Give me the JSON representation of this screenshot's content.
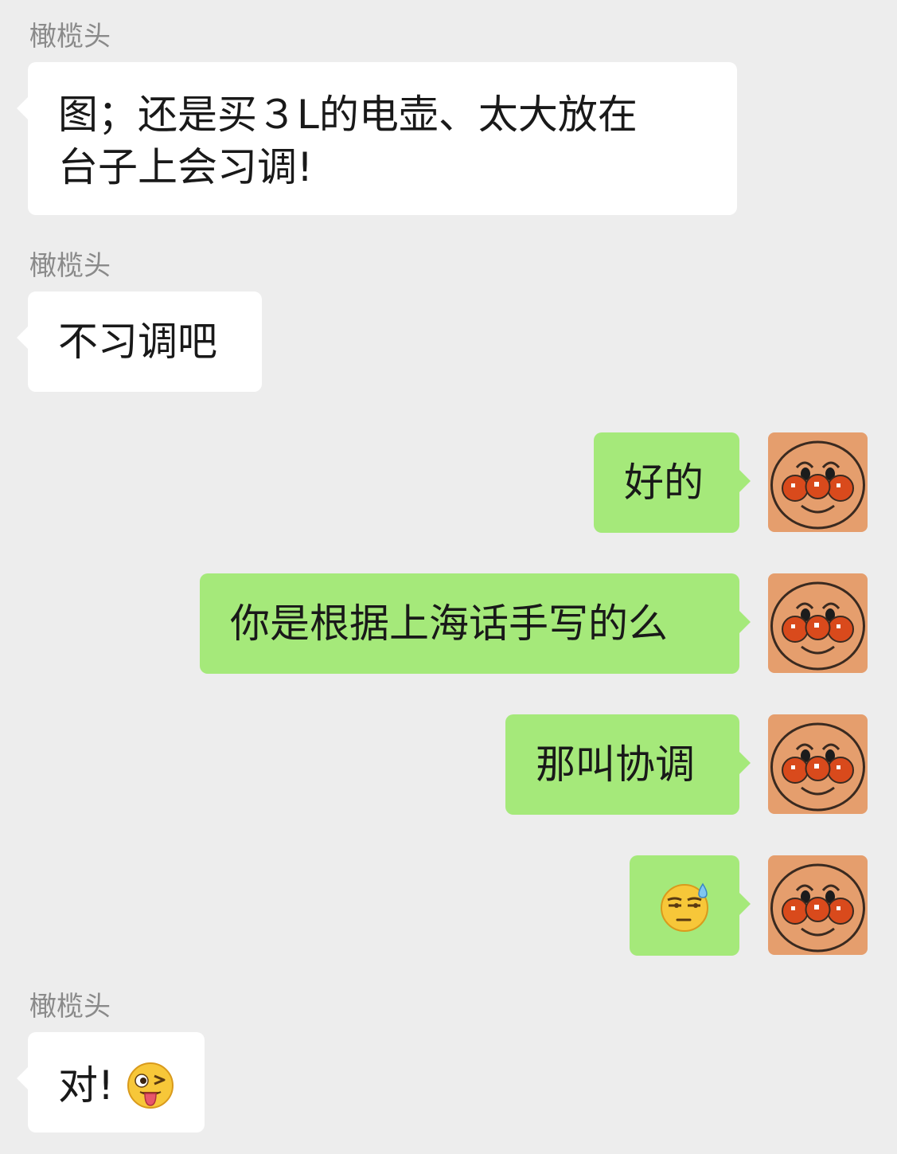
{
  "messages": [
    {
      "direction": "incoming",
      "sender": "橄榄头",
      "lines": [
        "图；还是买３L的电壶、太大放在",
        "台子上会习调!"
      ]
    },
    {
      "direction": "incoming",
      "sender": "橄榄头",
      "text": "不习调吧"
    },
    {
      "direction": "outgoing",
      "text": "好的",
      "avatar": "anpanman-face-avatar"
    },
    {
      "direction": "outgoing",
      "text": "你是根据上海话手写的么",
      "avatar": "anpanman-face-avatar"
    },
    {
      "direction": "outgoing",
      "text": "那叫协调",
      "avatar": "anpanman-face-avatar"
    },
    {
      "direction": "outgoing",
      "emoji": "awkward-sweat-emoji",
      "avatar": "anpanman-face-avatar"
    },
    {
      "direction": "incoming",
      "sender": "橄榄头",
      "text": "对!",
      "emoji": "wink-tongue-emoji"
    }
  ],
  "colors": {
    "background": "#ededed",
    "incoming_bubble": "#ffffff",
    "outgoing_bubble": "#a5e97a",
    "sender_name": "#8a8a8a",
    "avatar_bg": "#e59e6d"
  }
}
